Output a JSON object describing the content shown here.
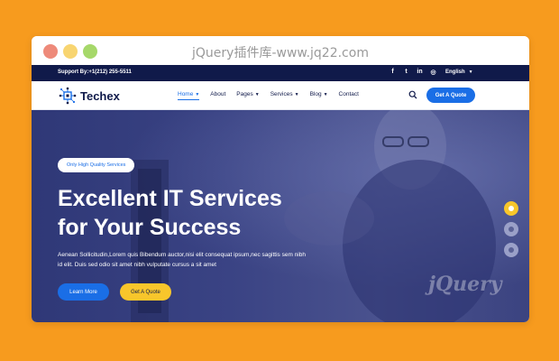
{
  "window": {
    "title": "jQuery插件库-www.jq22.com"
  },
  "topbar": {
    "support": "Support By:+1(212) 255-5511",
    "social_icons": [
      "facebook-icon",
      "twitter-icon",
      "linkedin-icon",
      "instagram-icon"
    ],
    "social_glyphs": [
      "f",
      "t",
      "in",
      "◎"
    ],
    "language": "English"
  },
  "nav": {
    "brand": "Techex",
    "items": [
      {
        "label": "Home",
        "dropdown": true,
        "active": true
      },
      {
        "label": "About",
        "dropdown": false
      },
      {
        "label": "Pages",
        "dropdown": true
      },
      {
        "label": "Services",
        "dropdown": true
      },
      {
        "label": "Blog",
        "dropdown": true
      },
      {
        "label": "Contact",
        "dropdown": false
      }
    ],
    "quote_button": "Get A Quote"
  },
  "hero": {
    "badge": "Only High Quality Services",
    "headline_line1": "Excellent IT Services",
    "headline_line2": "for Your Success",
    "description": "Aenean Sollicitudin,Lorem quis Bibendum auctor,nisi elit consequat ipsum,nec sagittis sem nibh id elit. Duis sed odio sit amet nibh vulputate cursus a sit amet",
    "learn_more": "Learn More",
    "get_quote": "Get A Quote",
    "slides": 3,
    "active_slide": 1,
    "watermark": "jQuery"
  },
  "colors": {
    "page_bg": "#f79b1e",
    "navy": "#101a4a",
    "blue": "#1a6ee6",
    "yellow": "#f8c62b"
  }
}
